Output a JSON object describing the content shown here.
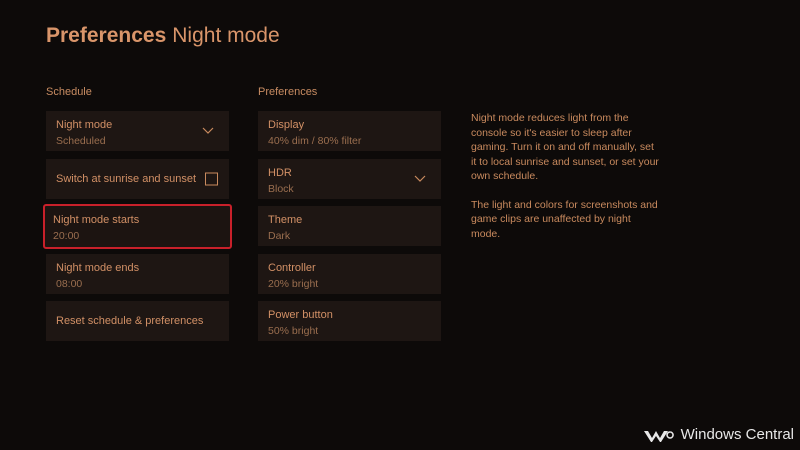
{
  "header": {
    "section": "Preferences",
    "page": "Night mode"
  },
  "schedule": {
    "heading": "Schedule",
    "night_mode": {
      "label": "Night mode",
      "value": "Scheduled",
      "icon": "chevron-down-icon"
    },
    "sunrise_sunset": {
      "label": "Switch at sunrise and sunset",
      "checked": false
    },
    "starts": {
      "label": "Night mode starts",
      "value": "20:00"
    },
    "ends": {
      "label": "Night mode ends",
      "value": "08:00"
    },
    "reset": {
      "label": "Reset schedule & preferences"
    }
  },
  "preferences": {
    "heading": "Preferences",
    "display": {
      "label": "Display",
      "value": "40% dim / 80% filter"
    },
    "hdr": {
      "label": "HDR",
      "value": "Block",
      "icon": "chevron-down-icon"
    },
    "theme": {
      "label": "Theme",
      "value": "Dark"
    },
    "controller": {
      "label": "Controller",
      "value": "20% bright"
    },
    "power_button": {
      "label": "Power button",
      "value": "50% bright"
    }
  },
  "description": {
    "paragraph1": "Night mode reduces light from the console so it's easier to sleep after gaming. Turn it on and off manually, set it to local sunrise and sunset, or set your own schedule.",
    "paragraph2": "The light and colors for screenshots and game clips are unaffected by night mode."
  },
  "watermark": {
    "text": "Windows Central",
    "logo": "windows-central-logo"
  },
  "colors": {
    "background": "#0d0a09",
    "tile": "#1e1613",
    "accent_text": "#c98a5e",
    "focus_border": "#c8202a"
  }
}
